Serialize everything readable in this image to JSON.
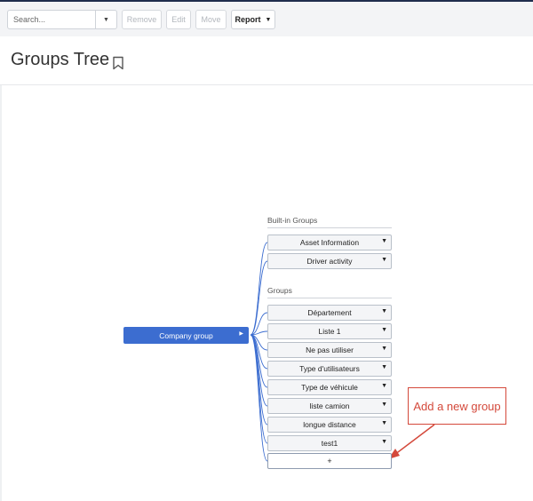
{
  "toolbar": {
    "search_placeholder": "Search...",
    "remove_label": "Remove",
    "edit_label": "Edit",
    "move_label": "Move",
    "report_label": "Report"
  },
  "page": {
    "title": "Groups Tree"
  },
  "tree": {
    "root_label": "Company group",
    "builtin_heading": "Built-in Groups",
    "builtin_groups": [
      "Asset Information",
      "Driver activity"
    ],
    "groups_heading": "Groups",
    "groups": [
      "Département",
      "Liste 1",
      "Ne pas utiliser",
      "Type d'utilisateurs",
      "Type de véhicule",
      "liste camion",
      "longue distance",
      "test1"
    ],
    "add_label": "+"
  },
  "annotation": {
    "text": "Add a new group",
    "color": "#d4493b"
  },
  "colors": {
    "accent": "#3c6dd0",
    "annotation": "#d4493b"
  }
}
